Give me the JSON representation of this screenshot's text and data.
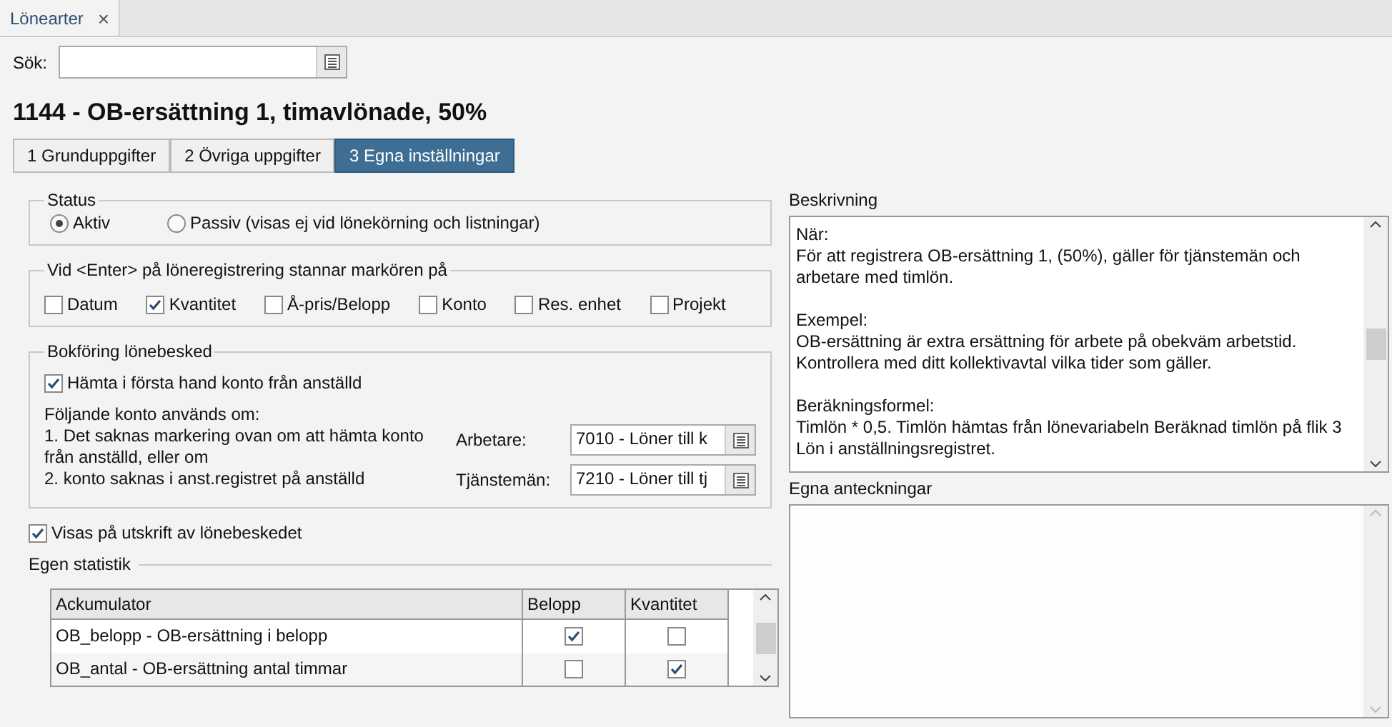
{
  "doc_tab": {
    "label": "Lönearter",
    "close": "×"
  },
  "search": {
    "label": "Sök:"
  },
  "title": "1144 - OB-ersättning 1, timavlönade, 50%",
  "tabs": [
    {
      "label": "1 Grunduppgifter",
      "selected": false
    },
    {
      "label": "2 Övriga uppgifter",
      "selected": false
    },
    {
      "label": "3 Egna inställningar",
      "selected": true
    }
  ],
  "status": {
    "legend": "Status",
    "options": [
      {
        "label": "Aktiv",
        "selected": true
      },
      {
        "label": "Passiv (visas ej vid lönekörning och listningar)",
        "selected": false
      }
    ]
  },
  "cursor_stop": {
    "legend": "Vid <Enter> på löneregistrering stannar markören på",
    "options": [
      {
        "label": "Datum",
        "checked": false
      },
      {
        "label": "Kvantitet",
        "checked": true
      },
      {
        "label": "Å-pris/Belopp",
        "checked": false
      },
      {
        "label": "Konto",
        "checked": false
      },
      {
        "label": "Res. enhet",
        "checked": false
      },
      {
        "label": "Projekt",
        "checked": false
      }
    ]
  },
  "booking": {
    "legend": "Bokföring lönebesked",
    "fetch_account": {
      "label": "Hämta i första hand konto från anställd",
      "checked": true
    },
    "note": [
      "Följande konto används om:",
      "1. Det saknas markering ovan om att hämta konto från anställd, eller om",
      "2. konto saknas i anst.registret på anställd"
    ],
    "accounts": [
      {
        "label": "Arbetare:",
        "value": "7010 - Löner till k"
      },
      {
        "label": "Tjänstemän:",
        "value": "7210 - Löner till tj"
      }
    ]
  },
  "show_on_print": {
    "label": "Visas på utskrift av lönebeskedet",
    "checked": true
  },
  "statistics": {
    "heading": "Egen statistik",
    "columns": [
      "Ackumulator",
      "Belopp",
      "Kvantitet"
    ],
    "rows": [
      {
        "name": "OB_belopp - OB-ersättning i belopp",
        "belopp": true,
        "kvantitet": false
      },
      {
        "name": "OB_antal - OB-ersättning antal timmar",
        "belopp": false,
        "kvantitet": true
      }
    ]
  },
  "description": {
    "label": "Beskrivning",
    "paragraphs": [
      "När:\nFör att registrera OB-ersättning 1, (50%), gäller för tjänstemän och arbetare med timlön.",
      "Exempel:\nOB-ersättning är extra ersättning för arbete på obekväm arbetstid. Kontrollera med ditt kollektivavtal vilka tider som gäller.",
      "Beräkningsformel:\nTimlön * 0,5. Timlön hämtas från lönevariabeln Beräknad timlön på flik 3 Lön i anställningsregistret."
    ]
  },
  "notes": {
    "label": "Egna anteckningar"
  }
}
